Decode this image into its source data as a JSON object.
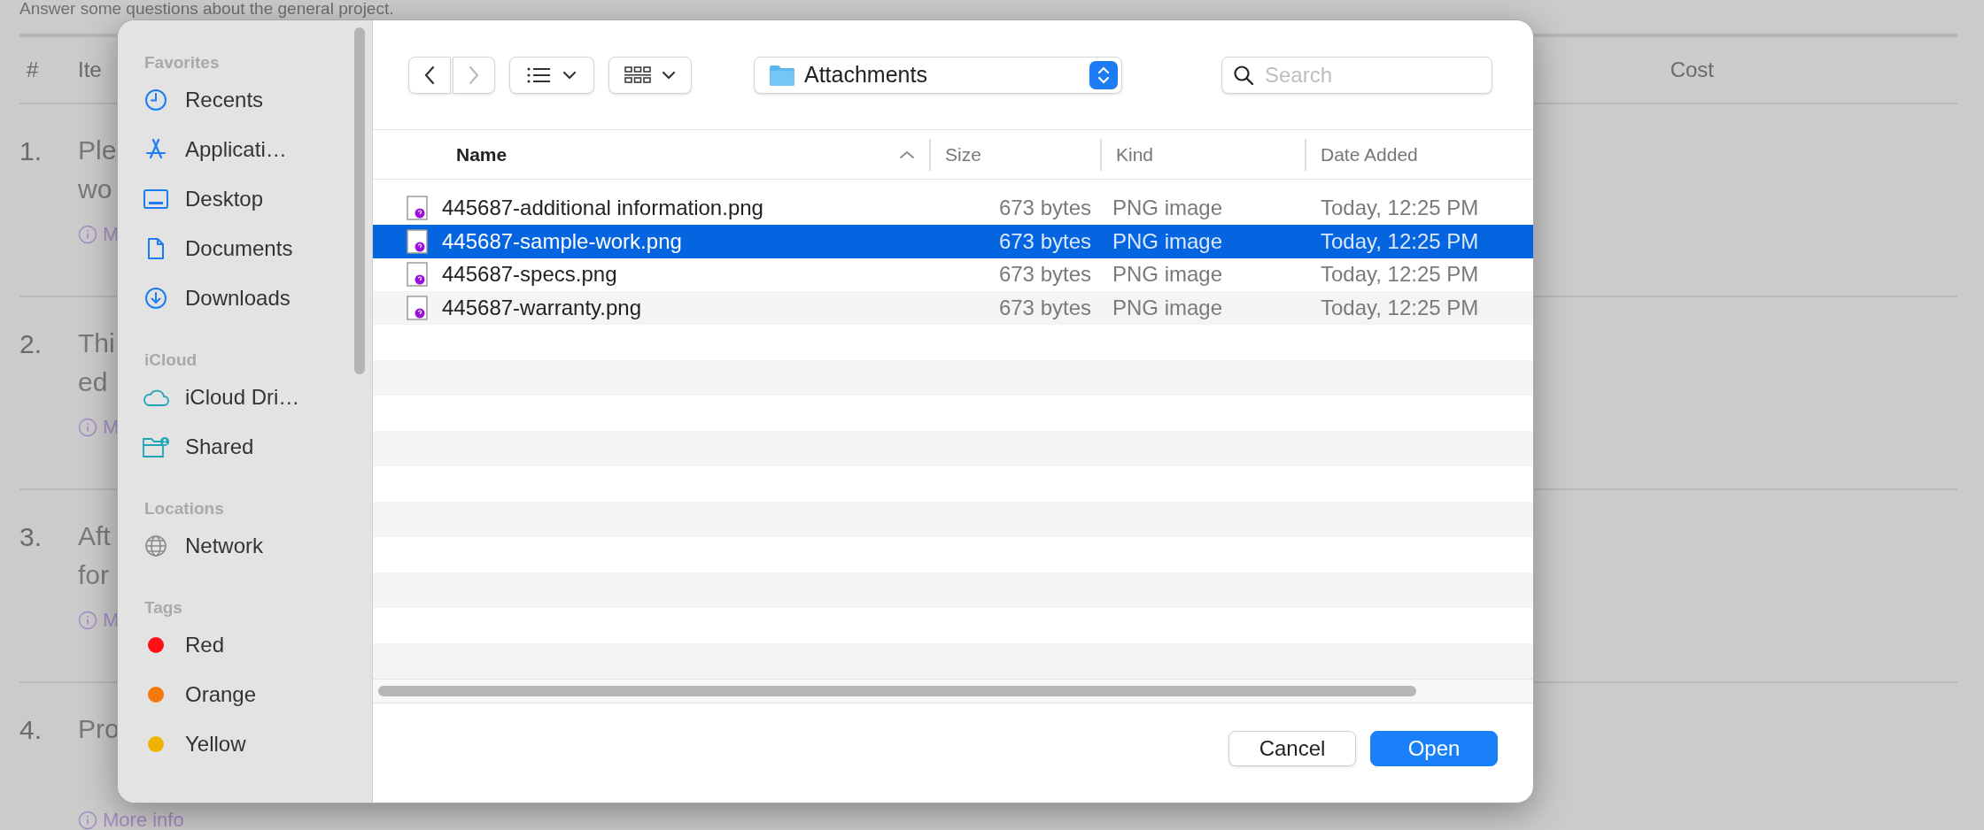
{
  "page": {
    "intro": "Answer some questions about the general project.",
    "columns": [
      "#",
      "Ite",
      "Cost"
    ],
    "rows": [
      {
        "number": "1.",
        "lines": [
          "Ple",
          "wo"
        ],
        "info": "M"
      },
      {
        "number": "2.",
        "lines": [
          "Thi",
          "ed"
        ],
        "info": "M"
      },
      {
        "number": "3.",
        "lines": [
          "Aft",
          "for"
        ],
        "info": "M"
      },
      {
        "number": "4.",
        "lines": [
          "Pro"
        ],
        "info": "More info"
      }
    ]
  },
  "dialog": {
    "sidebar": [
      {
        "heading": "Favorites",
        "items": [
          {
            "label": "Recents",
            "kind": "recents"
          },
          {
            "label": "Applicati…",
            "kind": "applications"
          },
          {
            "label": "Desktop",
            "kind": "desktop"
          },
          {
            "label": "Documents",
            "kind": "documents"
          },
          {
            "label": "Downloads",
            "kind": "downloads"
          }
        ]
      },
      {
        "heading": "iCloud",
        "items": [
          {
            "label": "iCloud Dri…",
            "kind": "cloud"
          },
          {
            "label": "Shared",
            "kind": "shared"
          }
        ]
      },
      {
        "heading": "Locations",
        "items": [
          {
            "label": "Network",
            "kind": "network"
          }
        ]
      },
      {
        "heading": "Tags",
        "items": [
          {
            "label": "Red",
            "kind": "tag",
            "color": "#fe0f1a"
          },
          {
            "label": "Orange",
            "kind": "tag",
            "color": "#f7780a"
          },
          {
            "label": "Yellow",
            "kind": "tag",
            "color": "#f0b200"
          }
        ]
      }
    ],
    "location": "Attachments",
    "search": {
      "placeholder": "Search"
    },
    "columns": [
      {
        "label": "Name",
        "sorted": true
      },
      {
        "label": "Size",
        "sorted": false
      },
      {
        "label": "Kind",
        "sorted": false
      },
      {
        "label": "Date Added",
        "sorted": false
      }
    ],
    "files": [
      {
        "name": "445687-additional information.png",
        "size": "673 bytes",
        "kind": "PNG image",
        "date": "Today, 12:25 PM",
        "selected": false
      },
      {
        "name": "445687-sample-work.png",
        "size": "673 bytes",
        "kind": "PNG image",
        "date": "Today, 12:25 PM",
        "selected": true
      },
      {
        "name": "445687-specs.png",
        "size": "673 bytes",
        "kind": "PNG image",
        "date": "Today, 12:25 PM",
        "selected": false
      },
      {
        "name": "445687-warranty.png",
        "size": "673 bytes",
        "kind": "PNG image",
        "date": "Today, 12:25 PM",
        "selected": false
      }
    ],
    "buttons": [
      {
        "label": "Cancel",
        "kind": "secondary"
      },
      {
        "label": "Open",
        "kind": "primary"
      }
    ]
  }
}
